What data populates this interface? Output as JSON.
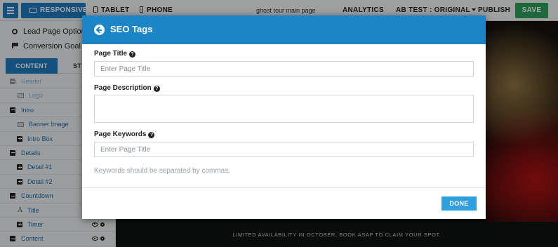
{
  "toolbar": {
    "responsive": "RESPONSIVE",
    "tablet": "TABLET",
    "phone": "PHONE",
    "page_name": "ghost tour main page",
    "analytics": "ANALYTICS",
    "ab_test": "AB TEST : ORIGINAL",
    "publish": "PUBLISH",
    "save": "SAVE",
    "accent": "#1f7bc1",
    "save_color": "#2fa05e"
  },
  "sidebar": {
    "options": [
      {
        "label": "Lead Page Options",
        "icon": "gear-icon"
      },
      {
        "label": "Conversion Goal",
        "icon": "flag-icon"
      }
    ],
    "tabs": [
      {
        "label": "CONTENT",
        "active": true
      },
      {
        "label": "STY",
        "active": false
      }
    ],
    "tree": [
      {
        "label": "Header",
        "kind": "section",
        "faded": true
      },
      {
        "label": "Logo",
        "kind": "image",
        "faded": true
      },
      {
        "label": "Intro",
        "kind": "section"
      },
      {
        "label": "Banner Image",
        "kind": "image"
      },
      {
        "label": "Intro Box",
        "kind": "group"
      },
      {
        "label": "Details",
        "kind": "section"
      },
      {
        "label": "Detail #1",
        "kind": "group"
      },
      {
        "label": "Detail #2",
        "kind": "group"
      },
      {
        "label": "Countdown",
        "kind": "section"
      },
      {
        "label": "Title",
        "kind": "text"
      },
      {
        "label": "Timer",
        "kind": "group"
      },
      {
        "label": "Content",
        "kind": "section"
      }
    ]
  },
  "canvas": {
    "banner_text": "LIMITED AVAILABILITY IN OCTOBER, BOOK ASAP TO CLAIM YOUR SPOT."
  },
  "modal": {
    "title": "SEO Tags",
    "header_color": "#1b85c8",
    "fields": {
      "page_title": {
        "label": "Page Title",
        "placeholder": "Enter Page Title",
        "value": ""
      },
      "page_description": {
        "label": "Page Description",
        "value": ""
      },
      "page_keywords": {
        "label": "Page Keywords",
        "placeholder": "Enter Page Title",
        "value": ""
      }
    },
    "help_glyph": "?",
    "hint": "Keywords should be separated by commas.",
    "done": "DONE"
  }
}
